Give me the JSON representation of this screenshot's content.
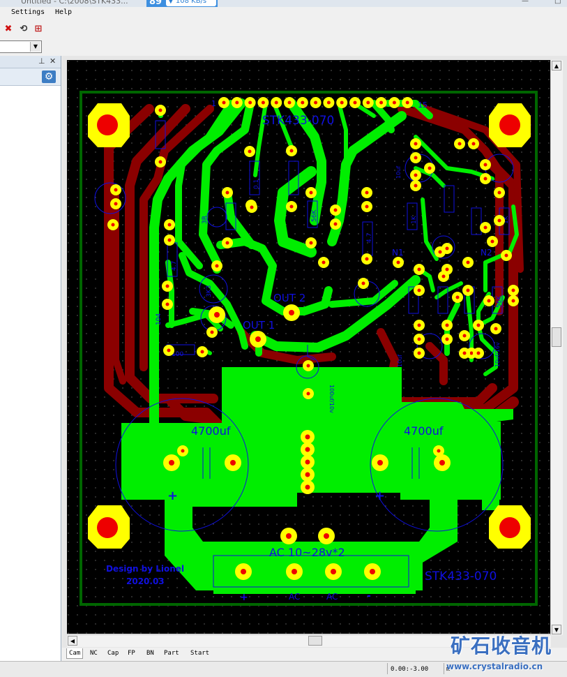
{
  "window": {
    "title_fragment": "Untitled - C:\\2008\\STK433...",
    "speed_badge": "89",
    "speed_rate": "▼ 108 KB/s",
    "minimize": "—",
    "maximize": "□",
    "close": "✕"
  },
  "menu": {
    "items": [
      "Settings",
      "Help"
    ]
  },
  "toolbar": {
    "buttons": [
      {
        "icon": "delete-x-icon",
        "glyph": "✖",
        "color": "#d01010"
      },
      {
        "icon": "undo-icon",
        "glyph": "⟲",
        "color": "#333333"
      },
      {
        "icon": "flip-board-icon",
        "glyph": "⊞",
        "color": "#c02020"
      }
    ],
    "combo_value": ""
  },
  "left_panel": {
    "pin": "⊥",
    "close": "✕",
    "gear": "⚙"
  },
  "pcb": {
    "silk_color": "#1010e0",
    "top_copper": "#00ee00",
    "bottom_copper": "#8b0000",
    "pad_color": "#ffff00",
    "drill_color": "#ee0000",
    "board_outline": "#006600",
    "labels": {
      "title_top": "STK433-070",
      "title_bottom": "STK433-070",
      "pin1": "1",
      "pin15": "15",
      "out1": "OUT 1",
      "out2": "OUT 2",
      "cap_left": "4700uf",
      "cap_right": "4700uf",
      "plus_left": "+",
      "plus_right": "+",
      "ac_input": "AC 10~28v*2",
      "design_by": "Design by Lionel",
      "date": "2020.03",
      "term_plus": "+",
      "term_ac1": "AC",
      "term_ac2": "AC",
      "term_minus": "-",
      "r_100": "100",
      "r_104": "104",
      "c_47_a": "4.7",
      "c_47_b": "4.7",
      "c_100uf": "100uf/10v",
      "c_10uf_a": "10uf",
      "c_10uf_b": "10uf",
      "c_10uf16v": "10uf/16v",
      "r_1k_a": "1K",
      "r_1k_b": "1K",
      "r_56k_a": "56K",
      "r_56k_b": "56K",
      "r_3k3": "3K3",
      "r_3r": "3R",
      "n1": "N1",
      "n2": "N2",
      "r_0_1": "0.1"
    }
  },
  "tabs": [
    "Cam",
    "NC",
    "Cap",
    "FP",
    "BN",
    "Part",
    "Start"
  ],
  "active_tab": "Cam",
  "status": {
    "coord": "0.00:-3.00",
    "unit": "m"
  },
  "watermark": {
    "brand": "矿石收音机",
    "url": "www.crystalradio.cn"
  }
}
